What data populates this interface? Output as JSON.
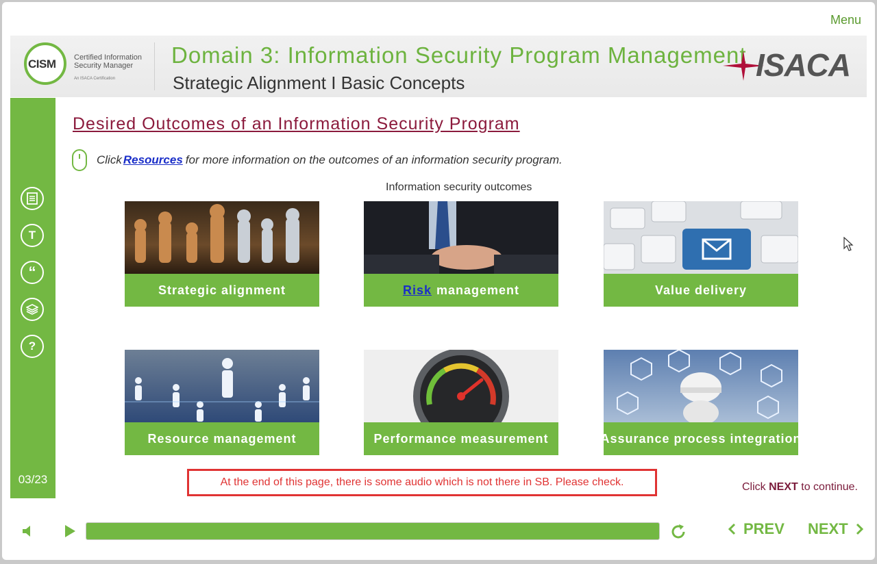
{
  "topbar": {
    "menu_label": "Menu"
  },
  "header": {
    "cism_logo_text": "CISM",
    "cism_logo_line1": "Certified Information",
    "cism_logo_line2": "Security Manager",
    "cism_logo_tagline": "An ISACA Certification",
    "domain_title": "Domain 3: Information Security Program Management",
    "subtitle": "Strategic Alignment I Basic Concepts",
    "isaca_logo_text": "ISACA"
  },
  "sidebar": {
    "icons": [
      {
        "name": "notes-icon"
      },
      {
        "name": "transcript-icon",
        "glyph": "T"
      },
      {
        "name": "quote-icon",
        "glyph": "“"
      },
      {
        "name": "layers-icon"
      },
      {
        "name": "help-icon",
        "glyph": "?"
      }
    ],
    "page_number": "03/23"
  },
  "content": {
    "title": "Desired Outcomes of an Information Security Program",
    "instruction_prefix": "Click",
    "resources_link": "Resources",
    "instruction_suffix": "for more information on the outcomes of an information security program.",
    "caption": "Information security outcomes",
    "cards": [
      {
        "label": "Strategic alignment"
      },
      {
        "link": "Risk",
        "label": "management"
      },
      {
        "label": "Value delivery"
      },
      {
        "label": "Resource management"
      },
      {
        "label": "Performance measurement"
      },
      {
        "label": "Assurance process integration"
      }
    ],
    "review_note": "At the end of this page, there is some audio which is not there in SB. Please check.",
    "continue_prefix": "Click",
    "continue_bold": "NEXT",
    "continue_suffix": "to continue."
  },
  "player": {
    "progress_fraction": 1.0,
    "prev_label": "PREV",
    "next_label": "NEXT"
  },
  "colors": {
    "brand_green": "#73b843",
    "title_maroon": "#8b1a3c",
    "link_blue": "#1a2ec8",
    "alert_red": "#e03333"
  }
}
